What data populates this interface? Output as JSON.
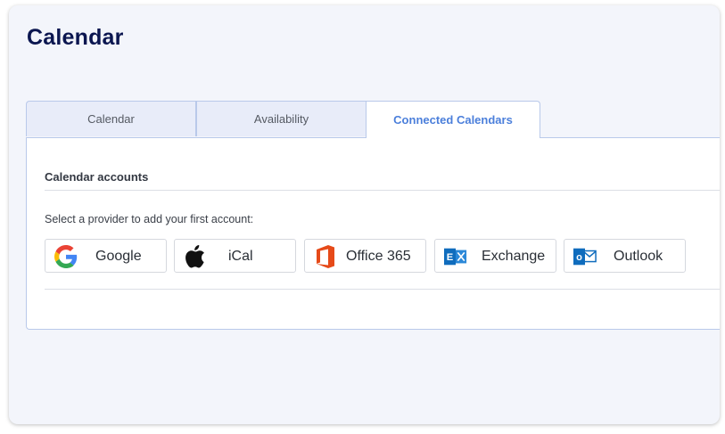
{
  "page": {
    "title": "Calendar"
  },
  "tabs": [
    {
      "label": "Calendar",
      "active": false
    },
    {
      "label": "Availability",
      "active": false
    },
    {
      "label": "Connected Calendars",
      "active": true
    }
  ],
  "accounts": {
    "section_title": "Calendar accounts",
    "prompt": "Select a provider to add your first account:",
    "providers": [
      {
        "label": "Google",
        "icon": "google-icon"
      },
      {
        "label": "iCal",
        "icon": "apple-icon"
      },
      {
        "label": "Office 365",
        "icon": "office365-icon"
      },
      {
        "label": "Exchange",
        "icon": "exchange-icon"
      },
      {
        "label": "Outlook",
        "icon": "outlook-icon"
      }
    ]
  },
  "colors": {
    "title": "#0b1650",
    "active_tab_text": "#4b7fdb",
    "tab_border": "#b9c9ea",
    "office_orange": "#e64a19",
    "ms_blue": "#0f6cbd"
  }
}
